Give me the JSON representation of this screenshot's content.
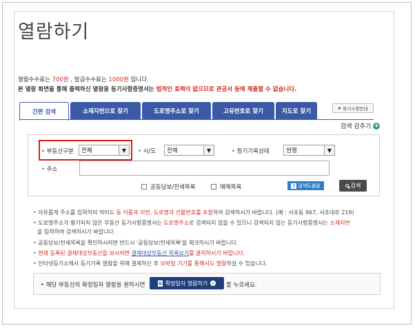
{
  "page": {
    "title": "열람하기"
  },
  "fees": {
    "line1_prefix": "열람수수료는 ",
    "view_fee": "700원",
    "line1_mid": " , 발급수수료는 ",
    "issue_fee": "1000원",
    "line1_suffix": " 입니다.",
    "line2_prefix": "본 열람 화면을 통해 출력하신 열람용 등기사항증명서는 ",
    "line2_red": "법적인 효력이 없으므로 관공서 등에 제출할 수 없습니다."
  },
  "tabs": [
    {
      "label": "간편 검색",
      "active": true
    },
    {
      "label": "소재지번으로 찾기",
      "active": false
    },
    {
      "label": "도로명주소로 찾기",
      "active": false
    },
    {
      "label": "고유번호로 찾기",
      "active": false
    },
    {
      "label": "지도로 찾기",
      "active": false
    }
  ],
  "help_button": "등기소찾안내",
  "search_toggle": "검색 감추기",
  "form": {
    "property_type_label": "부동산구분",
    "property_type_value": "전체",
    "region_label": "시/도",
    "region_value": "전체",
    "status_label": "등기기록상태",
    "status_value": "현행",
    "address_label": "주소",
    "address_value": "",
    "collateral_label": "공동담보/전세목록",
    "sale_label": "매매목록",
    "guide_button": "검색도움말",
    "search_button": "검색"
  },
  "notes": {
    "n1_a": "자유롭게 주소를 입력하되 적어도 ",
    "n1_red": "동 이름과 지번, 도로명과 건물번호를 포함",
    "n1_b": "하여 검색하시기 바랍니다. (예 : 서초동 967, 서초대로 219)",
    "n2_a": "도로명주소가 병기되지 않은 부동산 등기사항증명서는 ",
    "n2_red1": "도로명주소",
    "n2_b": "로 검색되지 않을 수 있으니 검색되지 않는 등기사항증명서는 ",
    "n2_red2": "소재지번",
    "n3": "을 입력하여 검색하시기 바랍니다.",
    "n4": "공동담보/전세목록을 확인하시려면 반드시 '공동담보/전세목록'을 체크하시기 바랍니다.",
    "n5_red": "현재 등록된 결제대상부동산을 보시려면 ",
    "n5_blue": "결제대상부동산 목록보기",
    "n5_red2": "를 클릭하시기 바랍니다.",
    "n6_a": "인터넷등기소에서 등기기록 열람을 위해 결제하신 후 ",
    "n6_red": "모바일 기기를 통해서도 열람",
    "n6_b": "하실 수 있습니다."
  },
  "bottom": {
    "text_before": "해당 부동산의 확정일자 열람을 원하시면",
    "button": "확정일자 열람하기",
    "text_after": "를 누르세요."
  },
  "colors": {
    "tab_blue": "#3b5aa6",
    "highlight_red": "#e01818",
    "warning_red": "#d2281e"
  }
}
